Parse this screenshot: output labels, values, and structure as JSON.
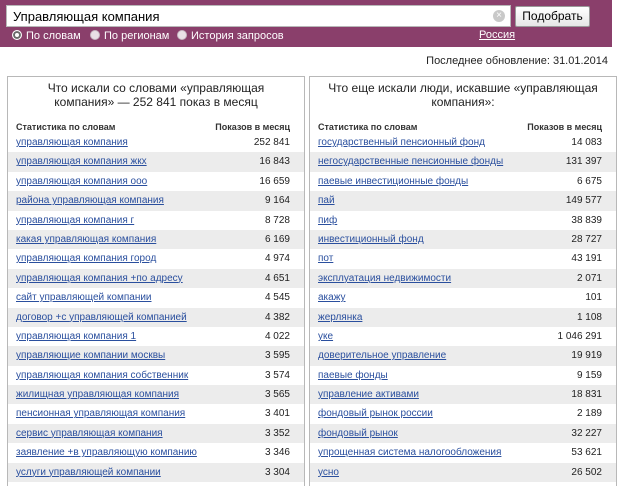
{
  "search": {
    "value": "Управляющая компания",
    "submit_label": "Подобрать",
    "clear_glyph": "×"
  },
  "modes": [
    {
      "label": "По словам",
      "selected": true
    },
    {
      "label": "По регионам",
      "selected": false
    },
    {
      "label": "История запросов",
      "selected": false
    }
  ],
  "region": "Россия",
  "last_update": "Последнее обновление: 31.01.2014",
  "left": {
    "title_line1": "Что искали со словами «управляющая",
    "title_line2": "компания» — 252 841 показ в месяц",
    "col_keyword": "Статистика по словам",
    "col_count": "Показов в месяц",
    "rows": [
      {
        "kw": "управляющая компания",
        "n": "252 841"
      },
      {
        "kw": "управляющая компания жкх",
        "n": "16 843"
      },
      {
        "kw": "управляющая компания ооо",
        "n": "16 659"
      },
      {
        "kw": "района управляющая компания",
        "n": "9 164"
      },
      {
        "kw": "управляющая компания г",
        "n": "8 728"
      },
      {
        "kw": "какая управляющая компания",
        "n": "6 169"
      },
      {
        "kw": "управляющая компания город",
        "n": "4 974"
      },
      {
        "kw": "управляющая компания +по адресу",
        "n": "4 651"
      },
      {
        "kw": "сайт управляющей компании",
        "n": "4 545"
      },
      {
        "kw": "договор +с управляющей компанией",
        "n": "4 382"
      },
      {
        "kw": "управляющая компания 1",
        "n": "4 022"
      },
      {
        "kw": "управляющие компании москвы",
        "n": "3 595"
      },
      {
        "kw": "управляющая компания собственник",
        "n": "3 574"
      },
      {
        "kw": "жилищная управляющая компания",
        "n": "3 565"
      },
      {
        "kw": "пенсионная управляющая компания",
        "n": "3 401"
      },
      {
        "kw": "сервис управляющая компания",
        "n": "3 352"
      },
      {
        "kw": "заявление +в управляющую компанию",
        "n": "3 346"
      },
      {
        "kw": "услуги управляющей компании",
        "n": "3 304"
      }
    ]
  },
  "right": {
    "title_line1": "Что еще искали люди, искавшие «управляющая",
    "title_line2": "компания»:",
    "col_keyword": "Статистика по словам",
    "col_count": "Показов в месяц",
    "rows": [
      {
        "kw": "государственный пенсионный фонд",
        "n": "14 083"
      },
      {
        "kw": "негосударственные пенсионные фонды",
        "n": "131 397"
      },
      {
        "kw": "паевые инвестиционные фонды",
        "n": "6 675"
      },
      {
        "kw": "пай",
        "n": "149 577"
      },
      {
        "kw": "пиф",
        "n": "38 839"
      },
      {
        "kw": "инвестиционный фонд",
        "n": "28 727"
      },
      {
        "kw": "пот",
        "n": "43 191"
      },
      {
        "kw": "эксплуатация недвижимости",
        "n": "2 071"
      },
      {
        "kw": "акажу",
        "n": "101"
      },
      {
        "kw": "жерлянка",
        "n": "1 108"
      },
      {
        "kw": "уке",
        "n": "1 046 291"
      },
      {
        "kw": "доверительное управление",
        "n": "19 919"
      },
      {
        "kw": "паевые фонды",
        "n": "9 159"
      },
      {
        "kw": "управление активами",
        "n": "18 831"
      },
      {
        "kw": "фондовый рынок россии",
        "n": "2 189"
      },
      {
        "kw": "фондовый рынок",
        "n": "32 227"
      },
      {
        "kw": "упрощенная система налогообложения",
        "n": "53 621"
      },
      {
        "kw": "усно",
        "n": "26 502"
      }
    ]
  }
}
